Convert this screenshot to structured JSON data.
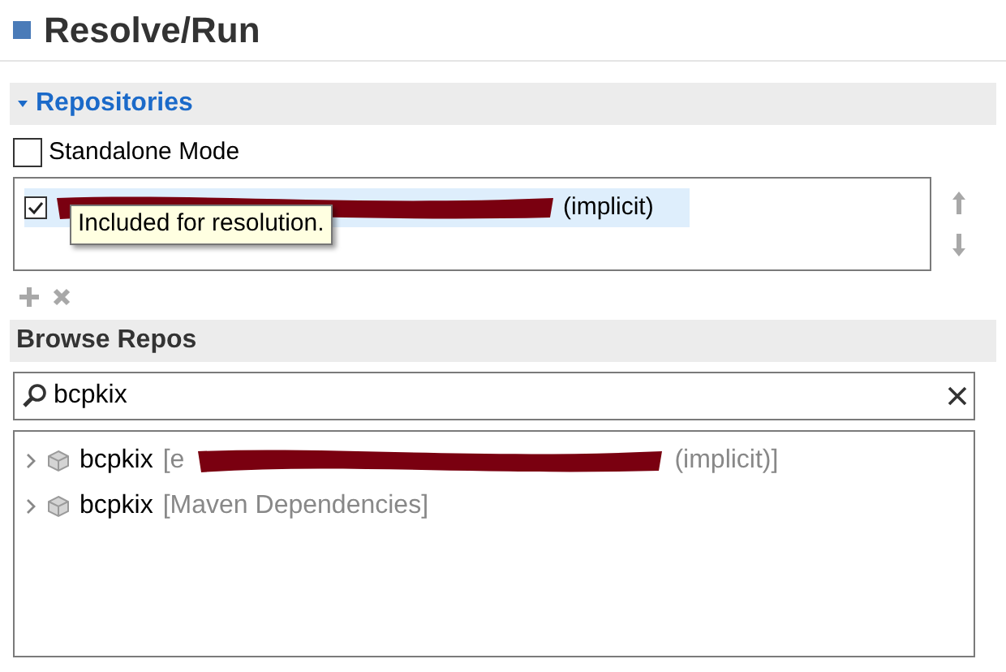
{
  "title": "Resolve/Run",
  "repositories": {
    "header": "Repositories",
    "expanded": true,
    "standalone": {
      "label": "Standalone Mode",
      "checked": false
    },
    "items": [
      {
        "checked": true,
        "selected": true,
        "redacted": true,
        "label": "(implicit)"
      }
    ],
    "tooltip": "Included for resolution."
  },
  "browse": {
    "header": "Browse Repos",
    "search": {
      "value": "bcpkix"
    },
    "results": [
      {
        "name": "bcpkix",
        "redacted": true,
        "source": "(implicit)]",
        "prefix": "[e"
      },
      {
        "name": "bcpkix",
        "redacted": false,
        "source": "[Maven Dependencies]"
      }
    ]
  }
}
